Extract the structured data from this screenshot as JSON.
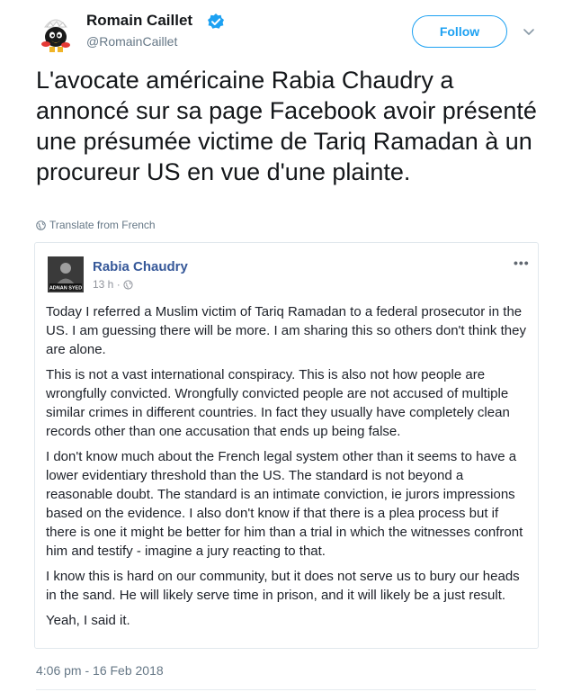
{
  "author": {
    "name": "Romain Caillet",
    "handle": "@RomainCaillet",
    "verified": true
  },
  "follow_label": "Follow",
  "tweet": {
    "text": "L'avocate américaine Rabia Chaudry a annoncé sur sa page Facebook avoir présenté une présumée victime de Tariq Ramadan à un procureur US en vue d'une plainte.",
    "translate_label": "Translate from French",
    "timestamp": "4:06 pm - 16 Feb 2018"
  },
  "embedded_post": {
    "author": "Rabia Chaudry",
    "avatar_caption": "ADNAN SYED",
    "time": "13 h ·",
    "more_label": "•••",
    "paragraphs": [
      "Today I referred a Muslim victim of Tariq Ramadan to a federal prosecutor in the US. I am guessing there will be more. I am sharing this so others don't think they are alone.",
      "This is not a vast international conspiracy. This is also not how people are wrongfully convicted. Wrongfully convicted people are not accused of multiple similar crimes in different countries. In fact they usually have completely clean records other than one accusation that ends up being false.",
      "I don't know much about the French legal system other than it seems to have a lower evidentiary threshold than the US. The standard is not beyond a reasonable doubt. The standard is an intimate conviction, ie jurors impressions based on the evidence. I also don't know if that there is a plea process but if there is one it might be better for him than a trial in which the witnesses confront him and testify - imagine a jury reacting to that.",
      "I know this is hard on our community, but it does not serve us to bury our heads in the sand. He will likely serve time in prison, and it will likely be a just result.",
      "Yeah, I said it."
    ]
  },
  "colors": {
    "twitter_blue": "#1da1f2",
    "facebook_blue": "#365899",
    "secondary_text": "#657786"
  }
}
